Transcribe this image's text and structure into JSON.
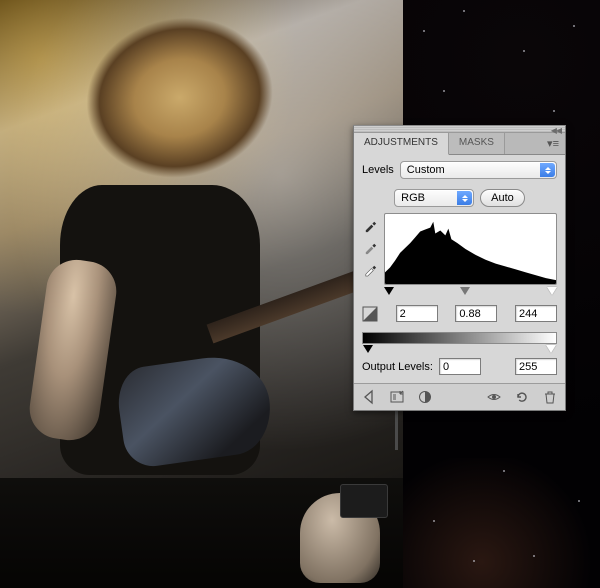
{
  "panel": {
    "tabs": {
      "adjustments": "ADJUSTMENTS",
      "masks": "MASKS"
    },
    "levels_label": "Levels",
    "preset": "Custom",
    "channel": "RGB",
    "auto_label": "Auto",
    "input": {
      "black": "2",
      "gamma": "0.88",
      "white": "244"
    },
    "output_label": "Output Levels:",
    "output": {
      "black": "0",
      "white": "255"
    },
    "eyedroppers": [
      "black-point",
      "gray-point",
      "white-point"
    ],
    "footer_icons": [
      "back-arrow",
      "expand-view",
      "clip-toggle",
      "view-previous",
      "reset",
      "trash"
    ]
  }
}
